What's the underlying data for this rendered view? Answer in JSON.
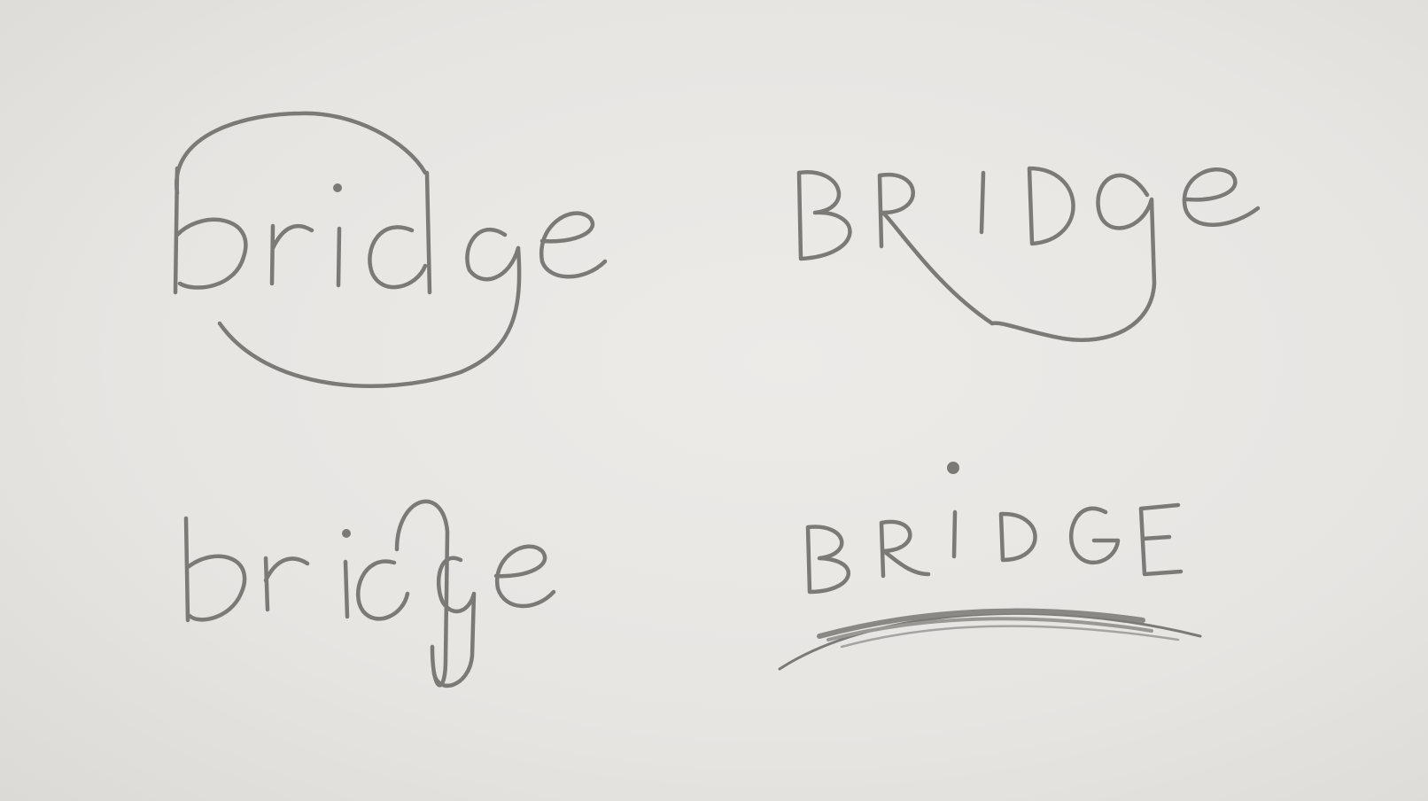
{
  "image": {
    "subject": "pencil logo sketches on paper",
    "pencil_color": "#7c7a77",
    "paper_color": "#e9e7e4"
  },
  "sketches": [
    {
      "word": "bridge",
      "decoration": "circle-arc"
    },
    {
      "word": "BRIDGe",
      "decoration": "swoop-under"
    },
    {
      "word": "bridge",
      "decoration": "arch-on-d"
    },
    {
      "word": "BRIDGE",
      "decoration": "shaded-arc-under"
    }
  ]
}
